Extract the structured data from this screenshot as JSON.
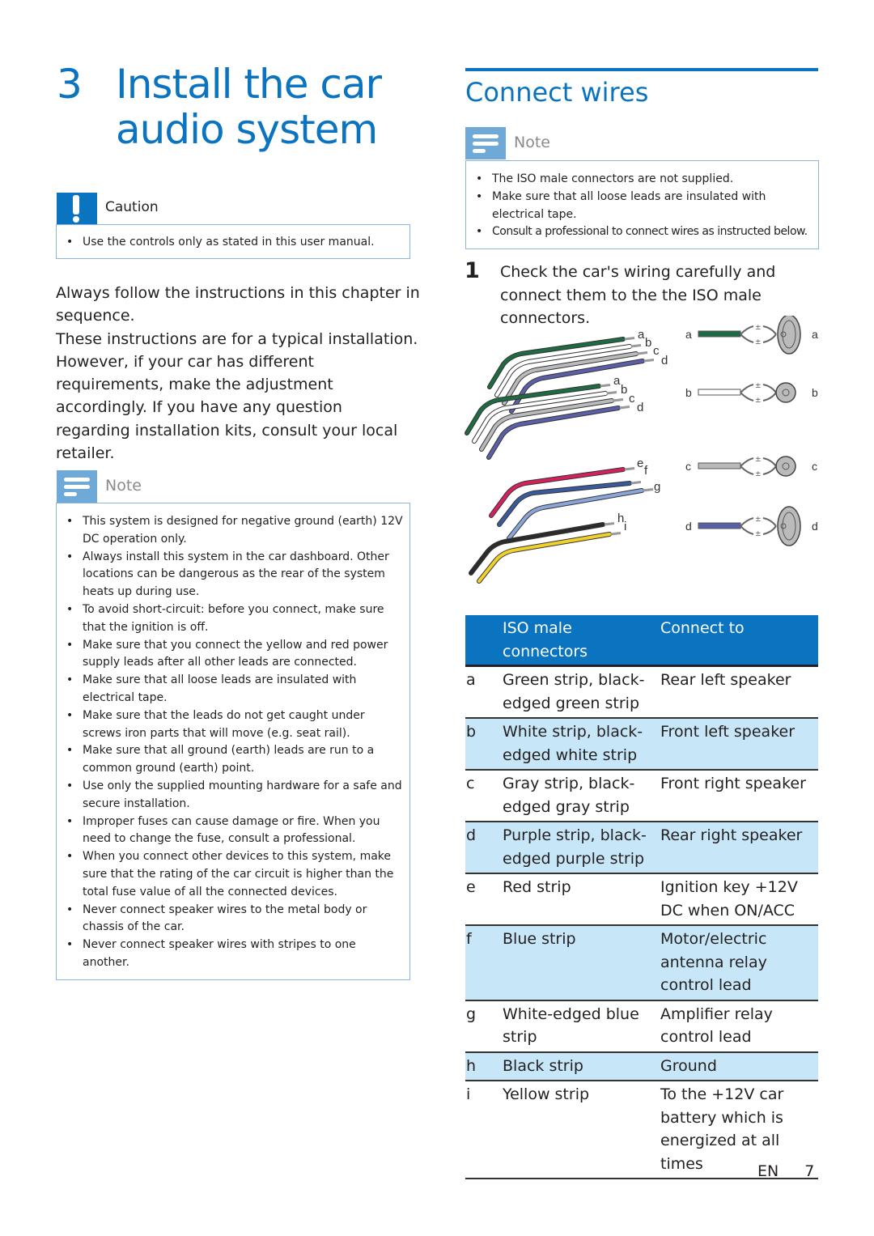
{
  "chapter": {
    "number": "3",
    "title": "Install the car audio system"
  },
  "caution": {
    "icon": "exclamation-icon",
    "title": "Caution",
    "items": [
      "Use the controls only as stated in this user manual."
    ]
  },
  "intro": {
    "paragraph1": "Always follow the instructions in this chapter in sequence.",
    "paragraph2": "These instructions are for a typical installation. However, if your car has different requirements, make the adjustment accordingly. If you have any question regarding installation kits, consult your local retailer."
  },
  "note_left": {
    "icon": "note-lines-icon",
    "title": "Note",
    "items": [
      "This system is designed for negative ground (earth) 12V DC operation only.",
      "Always install this system in the car dashboard. Other locations can be dangerous as the rear of the system heats up during use.",
      "To avoid short-circuit: before you connect, make sure that the ignition is off.",
      "Make sure that you connect the yellow and red power supply leads after all other leads are connected.",
      "Make sure that all loose leads are insulated with electrical tape.",
      "Make sure that the leads do not get caught under screws iron parts that will move (e.g. seat rail).",
      "Make sure that all ground (earth) leads are run to a common ground (earth) point.",
      "Use only the supplied mounting hardware for a safe and secure installation.",
      "Improper fuses can cause damage or fire. When you need to change the fuse, consult a professional.",
      "When you connect other devices to this system, make sure that the rating of the car circuit is higher than the total fuse value of all the connected devices.",
      "Never connect speaker wires to the metal body or chassis of the car.",
      "Never connect speaker wires with stripes to one another."
    ]
  },
  "section": {
    "title": "Connect wires"
  },
  "note_right": {
    "icon": "note-lines-icon",
    "title": "Note",
    "items": [
      "The ISO male connectors are not supplied.",
      "Make sure that all loose leads are insulated with electrical tape.",
      "Consult a professional to connect wires as instructed below."
    ]
  },
  "step1": {
    "number": "1",
    "text": "Check the car's wiring carefully and connect them to the the ISO male connectors."
  },
  "diagram": {
    "wire_labels_top": [
      "a",
      "b",
      "c",
      "d"
    ],
    "wire_labels_mid": [
      "a",
      "b",
      "c",
      "d"
    ],
    "wire_labels_bottom": [
      "e",
      "f",
      "g",
      "h",
      "i"
    ],
    "speakers": [
      {
        "label": "a",
        "color": "#1e6b43",
        "type": "oval"
      },
      {
        "label": "b",
        "color": "#ffffff",
        "type": "round"
      },
      {
        "label": "c",
        "color": "#b8babc",
        "type": "round"
      },
      {
        "label": "d",
        "color": "#5a5fa8",
        "type": "oval"
      }
    ],
    "wire_colors": {
      "green": "#1e6b43",
      "white": "#ffffff",
      "gray": "#b8babc",
      "purple": "#5a5fa8",
      "red": "#d3215c",
      "blue": "#3a5a9c",
      "white_edged_blue": "#8aa6d6",
      "black": "#2b2b2b",
      "yellow": "#f0d12a"
    }
  },
  "table": {
    "headers": [
      "",
      "ISO male connectors",
      "Connect to"
    ],
    "rows": [
      {
        "key": "a",
        "connector": "Green strip, black-edged green strip",
        "target": "Rear left speaker"
      },
      {
        "key": "b",
        "connector": "White strip, black-edged white strip",
        "target": "Front left speaker"
      },
      {
        "key": "c",
        "connector": "Gray strip, black-edged gray strip",
        "target": "Front right speaker"
      },
      {
        "key": "d",
        "connector": "Purple strip, black-edged purple strip",
        "target": "Rear right speaker"
      },
      {
        "key": "e",
        "connector": "Red strip",
        "target": "Ignition key +12V DC when ON/ACC"
      },
      {
        "key": "f",
        "connector": "Blue strip",
        "target": "Motor/electric antenna relay control lead"
      },
      {
        "key": "g",
        "connector": "White-edged blue strip",
        "target": "Amplifier relay control lead"
      },
      {
        "key": "h",
        "connector": "Black strip",
        "target": "Ground"
      },
      {
        "key": "i",
        "connector": "Yellow strip",
        "target": "To the +12V car battery which is energized at all times"
      }
    ]
  },
  "footer": {
    "language": "EN",
    "page": "7"
  },
  "colors": {
    "brand_blue": "#0a74c0",
    "note_icon_blue": "#6fa9d8",
    "table_shade": "#c7e6f7",
    "box_border": "#8cb6e0"
  }
}
